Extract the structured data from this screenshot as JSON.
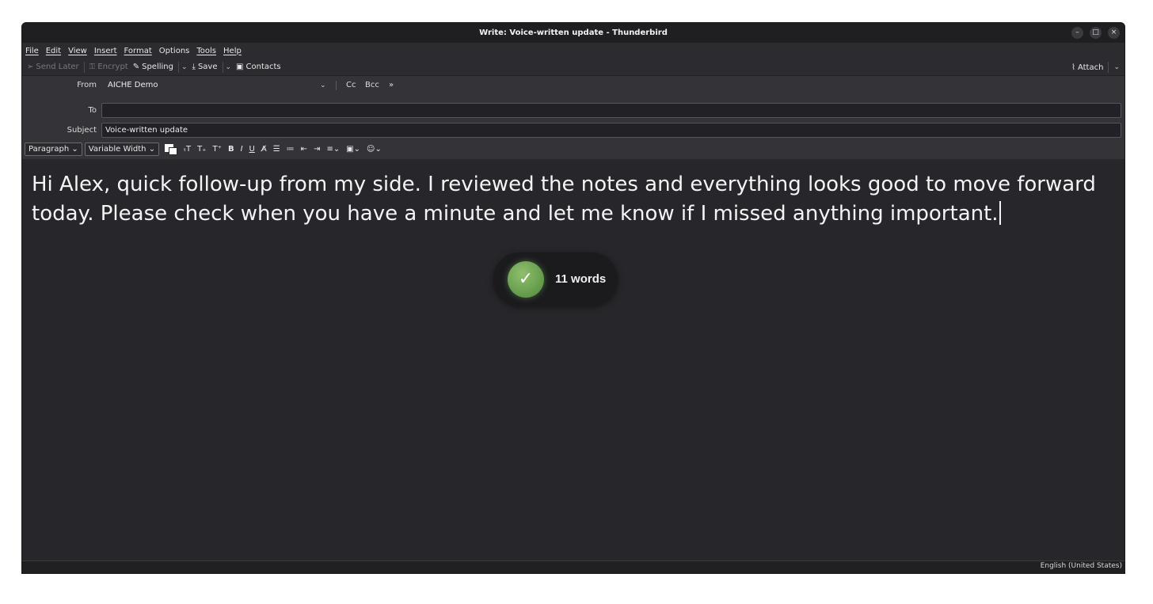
{
  "window": {
    "title": "Write: Voice-written update - Thunderbird"
  },
  "window_controls": [
    "–",
    "□",
    "×"
  ],
  "menubar": {
    "items": [
      "File",
      "Edit",
      "View",
      "Insert",
      "Format",
      "Options",
      "Tools",
      "Help"
    ]
  },
  "toolbar": {
    "send_later": "Send Later",
    "encrypt": "Encrypt",
    "spelling": "Spelling",
    "save": "Save",
    "contacts": "Contacts",
    "attach": "Attach"
  },
  "header": {
    "from_label": "From",
    "from_value": "AICHE Demo",
    "cc": "Cc",
    "bcc": "Bcc",
    "more": "»",
    "to_label": "To",
    "to_value": "",
    "subject_label": "Subject",
    "subject_value": "Voice-written update"
  },
  "format_bar": {
    "paragraph": "Paragraph",
    "font": "Variable Width"
  },
  "body": {
    "text": "Hi Alex, quick follow-up from my side. I reviewed the notes and everything looks good to move forward today. Please check when you have a minute and let me know if I missed anything important."
  },
  "toast": {
    "text": "11 words"
  },
  "status": {
    "language": "English (United States)"
  },
  "colors": {
    "accent": "#6aa84f",
    "background": "#27272b"
  }
}
